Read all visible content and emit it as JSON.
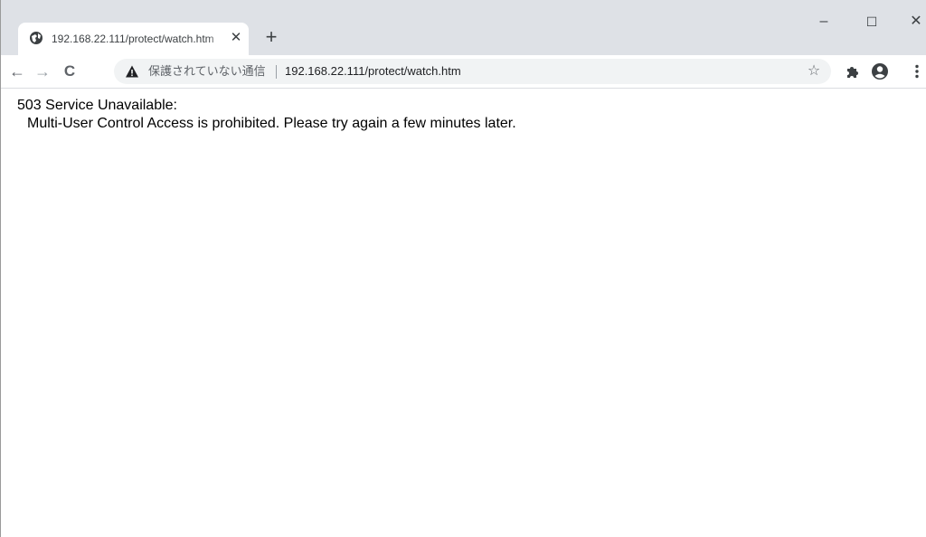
{
  "tab": {
    "title": "192.168.22.111/protect/watch.htm",
    "close_glyph": "✕",
    "favicon": "globe-icon"
  },
  "new_tab_glyph": "+",
  "window_controls": {
    "minimize": "–",
    "maximize": "☐",
    "close": "✕"
  },
  "toolbar": {
    "back_glyph": "←",
    "forward_glyph": "→",
    "reload_glyph": "C",
    "security_label": "保護されていない通信",
    "url": "192.168.22.111/protect/watch.htm",
    "star_glyph": "☆"
  },
  "page": {
    "heading": "503 Service Unavailable:",
    "message": "Multi-User Control Access is prohibited. Please try again a few minutes later."
  },
  "colors": {
    "tabstrip": "#dee1e6",
    "omnibox": "#f1f3f4",
    "icon": "#5f6368"
  }
}
